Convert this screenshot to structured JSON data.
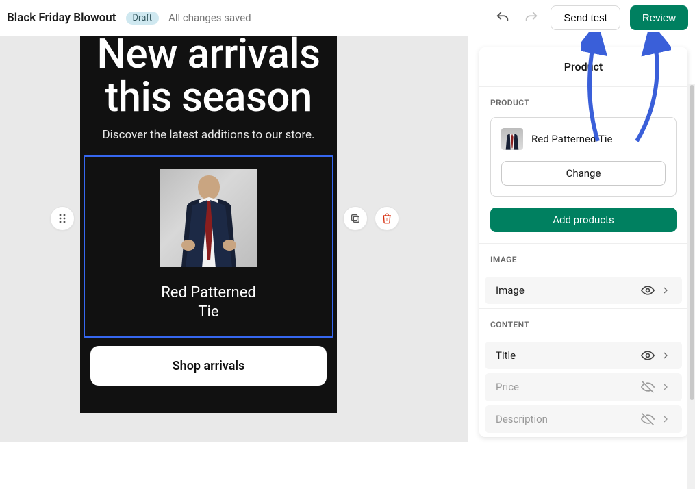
{
  "header": {
    "title": "Black Friday Blowout",
    "badge": "Draft",
    "status": "All changes saved",
    "send_test": "Send test",
    "review": "Review"
  },
  "email": {
    "hero_title": "New arrivals this season",
    "hero_sub": "Discover the latest additions to our store.",
    "product_title": "Red Patterned Tie",
    "shop_button": "Shop arrivals"
  },
  "panel": {
    "title": "Product",
    "product_section": "PRODUCT",
    "selected_product": "Red Patterned Tie",
    "change": "Change",
    "add_products": "Add products",
    "image_section": "IMAGE",
    "image_row": "Image",
    "content_section": "CONTENT",
    "title_row": "Title",
    "price_row": "Price",
    "description_row": "Description"
  },
  "icons": {
    "undo": "undo-icon",
    "redo": "redo-icon",
    "drag": "drag-handle-icon",
    "duplicate": "duplicate-icon",
    "trash": "trash-icon",
    "eye": "visible-icon",
    "eye_off": "hidden-icon",
    "chevron": "chevron-right-icon"
  },
  "colors": {
    "primary": "#008060",
    "selection": "#3667f0",
    "danger": "#d72c0d"
  }
}
